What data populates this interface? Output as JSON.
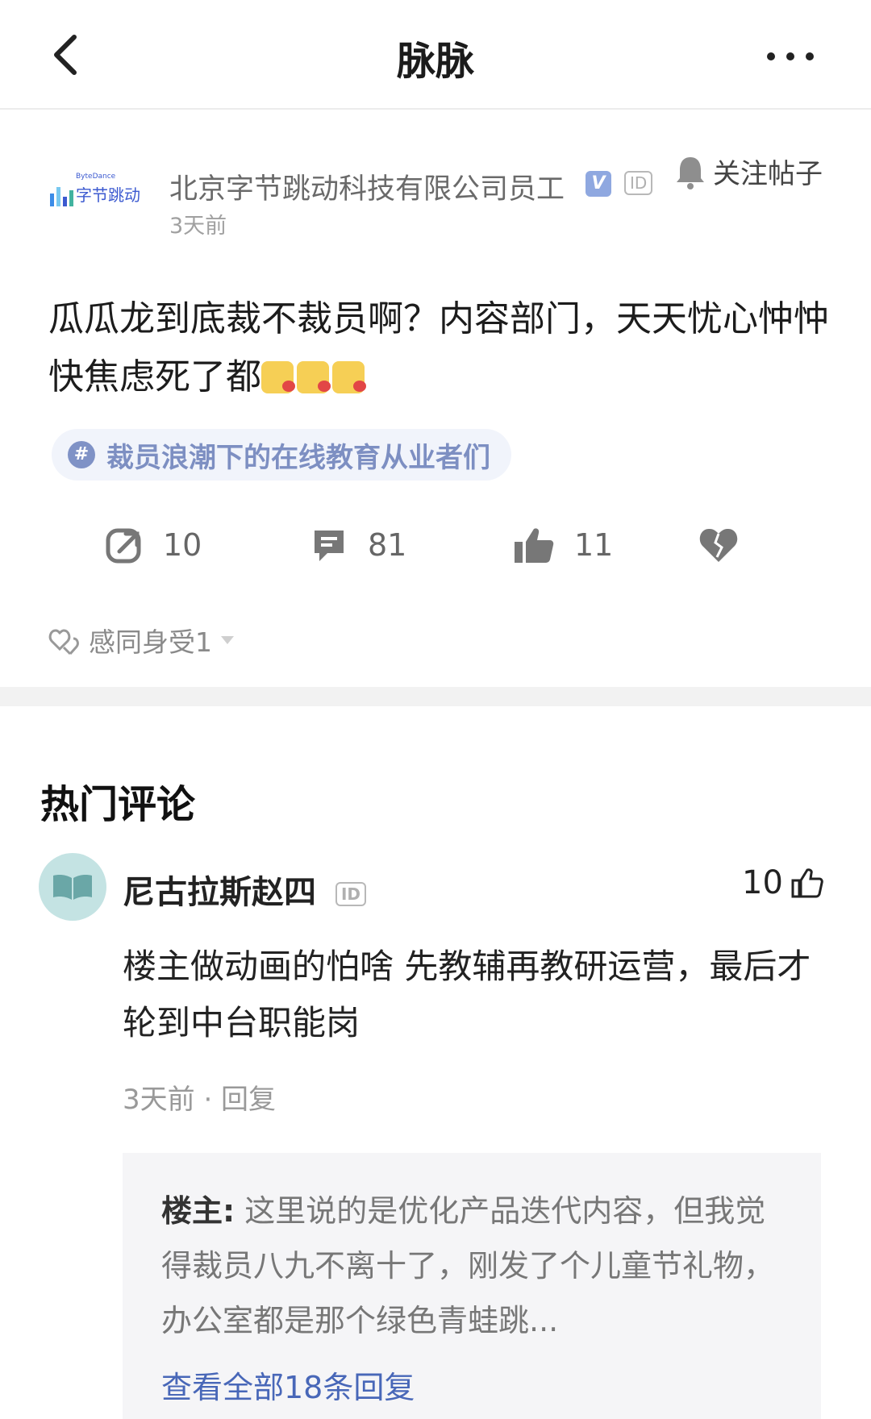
{
  "nav": {
    "title": "脉脉"
  },
  "post": {
    "company_logo_text": "字节跳动",
    "company_logo_small": "ByteDance",
    "author": "北京字节跳动科技有限公司员工",
    "verified_mark": "V",
    "id_badge": "ID",
    "time": "3天前",
    "follow_label": "关注帖子",
    "content": "瓜瓜龙到底裁不裁员啊？内容部门，天天忧心忡忡快焦虑死了都",
    "topic": "裁员浪潮下的在线教育从业者们",
    "actions": {
      "share_count": "10",
      "comment_count": "81",
      "like_count": "11"
    },
    "reaction_label": "感同身受1"
  },
  "comments": {
    "section_title": "热门评论",
    "items": [
      {
        "name": "尼古拉斯赵四",
        "id_badge": "ID",
        "likes": "10",
        "text": "楼主做动画的怕啥 先教辅再教研运营，最后才轮到中台职能岗",
        "meta": "3天前 · 回复",
        "reply": {
          "author": "楼主:",
          "text": " 这里说的是优化产品迭代内容，但我觉得裁员八九不离十了，刚发了个儿童节礼物，办公室都是那个绿色青蛙跳...",
          "view_all": "查看全部18条回复"
        }
      }
    ]
  },
  "colors": {
    "accent": "#4867b8",
    "tag": "#7d8fc2",
    "divider": "#f2f2f2"
  }
}
